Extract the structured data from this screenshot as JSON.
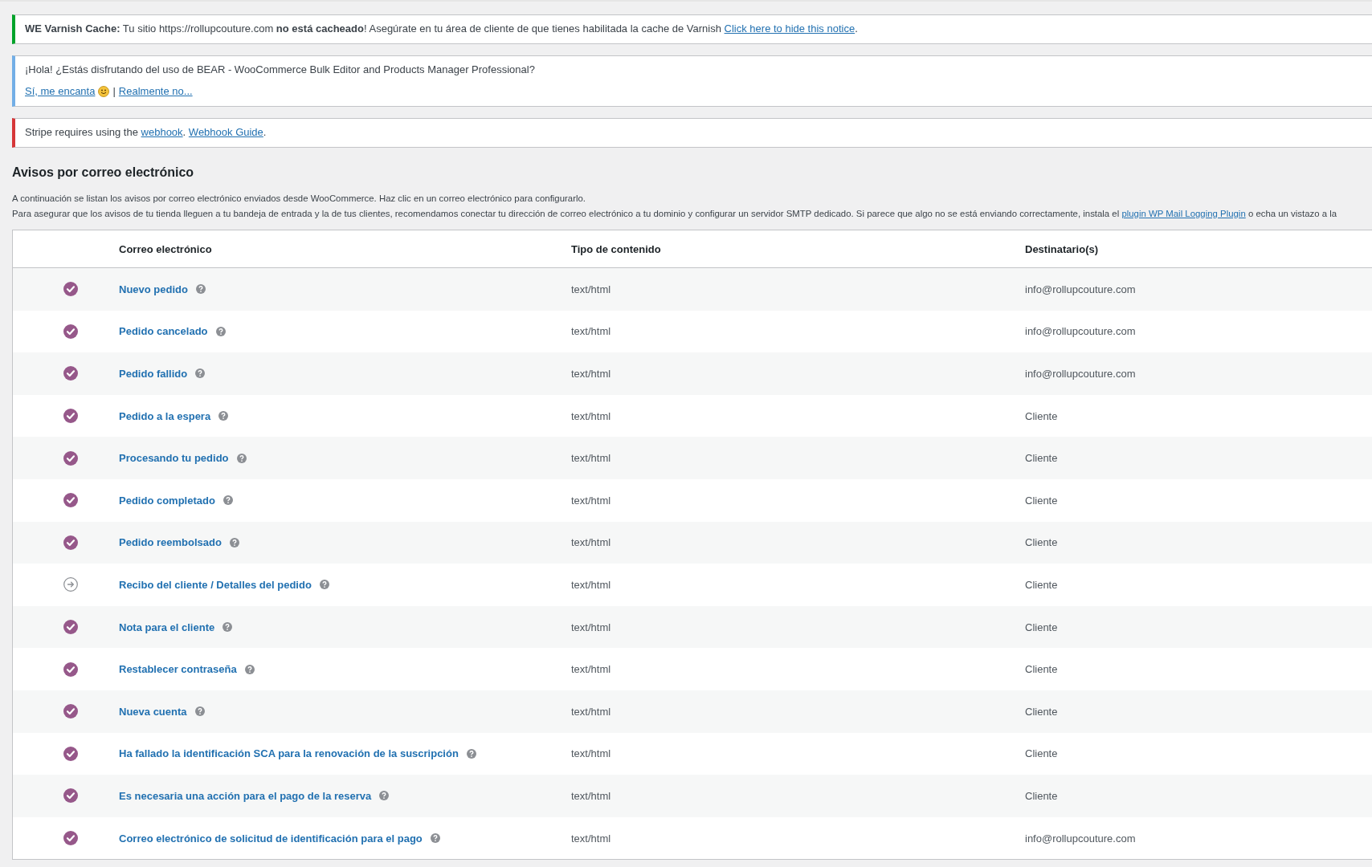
{
  "notices": [
    {
      "kind": "success",
      "text": "**WE Varnish Cache:** Tu sitio https://rollupcouture.com **no está cacheado**! Asegúrate en tu área de cliente de que tienes habilitada la cache de Varnish",
      "links": [
        "Click here to hide this notice"
      ],
      "tail": "."
    },
    {
      "kind": "info",
      "text": "¡Hola! ¿Estás disfrutando del uso de BEAR - WooCommerce Bulk Editor and Products Manager Professional?",
      "actions": [
        {
          "label": "Sí, me encanta"
        },
        {
          "label": "Realmente no..."
        }
      ],
      "separator": "|"
    },
    {
      "kind": "error",
      "text": "Stripe requires using the",
      "links": [
        "webhook",
        "Webhook Guide"
      ],
      "link_separator": ".",
      "tail": "."
    }
  ],
  "section": {
    "title": "Avisos por correo electrónico",
    "intro": "A continuación se listan los avisos por correo electrónico enviados desde WooCommerce. Haz clic en un correo electrónico para configurarlo.",
    "note": "Para asegurar que los avisos de tu tienda lleguen a tu bandeja de entrada y la de tus clientes, recomendamos conectar tu dirección de correo electrónico a tu dominio y configurar un servidor SMTP dedicado. Si parece que algo no se está enviando correctamente, instala el",
    "note_link": "plugin WP Mail Logging Plugin",
    "note_tail": "o echa un vistazo a la"
  },
  "table": {
    "columns": [
      "Correo electrónico",
      "Tipo de contenido",
      "Destinatario(s)"
    ],
    "rows": [
      {
        "enabled": true,
        "name": "Nuevo pedido",
        "type": "text/html",
        "recipient": "info@rollupcouture.com"
      },
      {
        "enabled": true,
        "name": "Pedido cancelado",
        "type": "text/html",
        "recipient": "info@rollupcouture.com"
      },
      {
        "enabled": true,
        "name": "Pedido fallido",
        "type": "text/html",
        "recipient": "info@rollupcouture.com"
      },
      {
        "enabled": true,
        "name": "Pedido a la espera",
        "type": "text/html",
        "recipient": "Cliente"
      },
      {
        "enabled": true,
        "name": "Procesando tu pedido",
        "type": "text/html",
        "recipient": "Cliente"
      },
      {
        "enabled": true,
        "name": "Pedido completado",
        "type": "text/html",
        "recipient": "Cliente"
      },
      {
        "enabled": true,
        "name": "Pedido reembolsado",
        "type": "text/html",
        "recipient": "Cliente"
      },
      {
        "enabled": false,
        "name": "Recibo del cliente / Detalles del pedido",
        "type": "text/html",
        "recipient": "Cliente"
      },
      {
        "enabled": true,
        "name": "Nota para el cliente",
        "type": "text/html",
        "recipient": "Cliente"
      },
      {
        "enabled": true,
        "name": "Restablecer contraseña",
        "type": "text/html",
        "recipient": "Cliente"
      },
      {
        "enabled": true,
        "name": "Nueva cuenta",
        "type": "text/html",
        "recipient": "Cliente"
      },
      {
        "enabled": true,
        "name": "Ha fallado la identificación SCA para la renovación de la suscripción",
        "type": "text/html",
        "recipient": "Cliente"
      },
      {
        "enabled": true,
        "name": "Es necesaria una acción para el pago de la reserva",
        "type": "text/html",
        "recipient": "Cliente"
      },
      {
        "enabled": true,
        "name": "Correo electrónico de solicitud de identificación para el pago",
        "type": "text/html",
        "recipient": "info@rollupcouture.com"
      }
    ]
  }
}
